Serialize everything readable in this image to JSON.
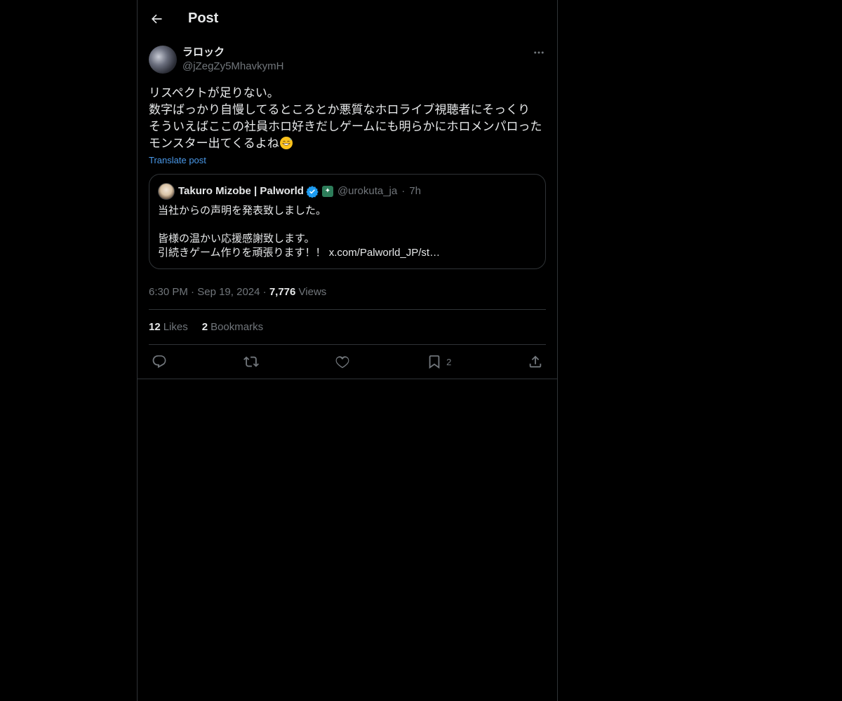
{
  "header": {
    "title": "Post"
  },
  "post": {
    "author_name": "ラロック",
    "author_handle": "@jZegZy5MhavkymH",
    "text": "リスペクトが足りない。\n数字ばっかり自慢してるところとか悪質なホロライブ視聴者にそっくり\nそういえばここの社員ホロ好きだしゲームにも明らかにホロメンパロった\nモンスター出てくるよね",
    "translate_label": "Translate post",
    "time": "6:30 PM",
    "date": "Sep 19, 2024",
    "views_count": "7,776",
    "views_label": "Views"
  },
  "quote": {
    "author_name": "Takuro Mizobe | Palworld",
    "author_handle": "@urokuta_ja",
    "time": "7h",
    "text": "当社からの声明を発表致しました。\n\n皆様の温かい応援感謝致します。\n引続きゲーム作りを頑張ります！！ x.com/Palworld_JP/st…"
  },
  "stats": {
    "likes_count": "12",
    "likes_label": "Likes",
    "bookmarks_count": "2",
    "bookmarks_label": "Bookmarks"
  },
  "actions": {
    "bookmark_count": "2"
  },
  "icons": [
    "arrow-left-icon",
    "more-icon",
    "verified-icon",
    "affiliate-badge-icon",
    "reply-icon",
    "repost-icon",
    "like-icon",
    "bookmark-icon",
    "share-icon",
    "grin-sweat-emoji"
  ],
  "colors": {
    "background": "#000000",
    "text": "#e7e9ea",
    "muted": "#71767b",
    "link": "#4a99e9",
    "verified": "#1d9bf0",
    "border": "#2f3336"
  }
}
